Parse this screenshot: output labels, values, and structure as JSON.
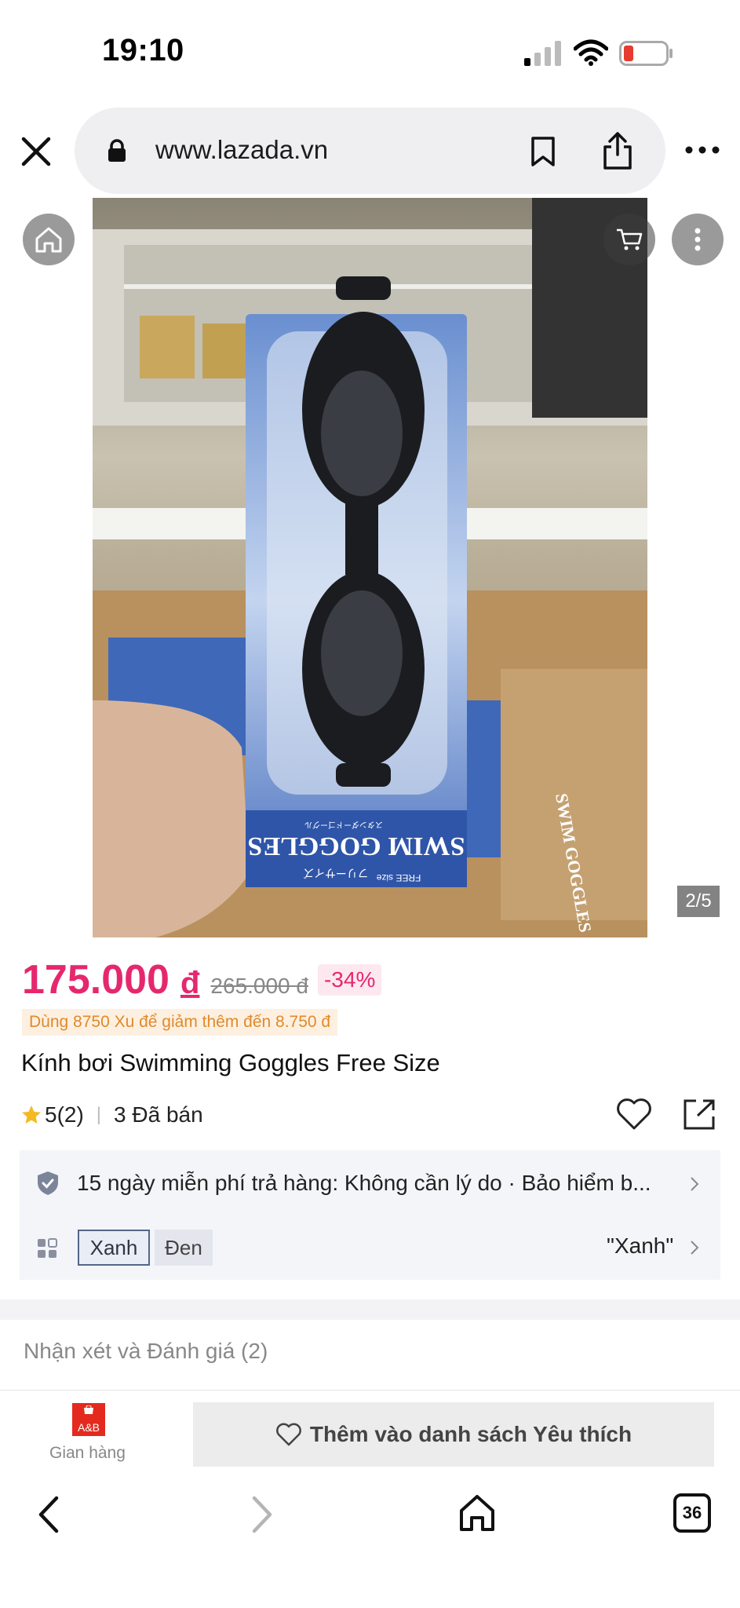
{
  "status_bar": {
    "time": "19:10"
  },
  "browser": {
    "url": "www.lazada.vn"
  },
  "product": {
    "image_counter": "2/5",
    "price": "175.000",
    "currency": "đ",
    "old_price": "265.000 đ",
    "discount": "-34%",
    "coin_note": "Dùng 8750 Xu để giảm thêm đến 8.750 đ",
    "title": "Kính bơi Swimming Goggles Free Size",
    "rating": "5(2)",
    "sold": "3 Đã bán",
    "packaging_text": "SWIM GOGGLES",
    "packaging_size": "FREE size",
    "packaging_jp": "フリーサイズ",
    "packaging_jp_sub": "スタンダードゴーグル"
  },
  "info_card": {
    "return_policy": "15 ngày miễn phí trả hàng: Không cần lý do · Bảo hiểm b...",
    "variants": [
      "Xanh",
      "Đen"
    ],
    "selected_variant": "\"Xanh\""
  },
  "reviews": {
    "title": "Nhận xét và Đánh giá (2)"
  },
  "action_bar": {
    "store_badge": "A&B",
    "store_label": "Gian hàng",
    "wishlist_label": "Thêm vào danh sách Yêu thích"
  },
  "nav": {
    "tab_count": "36"
  },
  "colors": {
    "accent": "#e5286e",
    "coin": "#e08a2c"
  },
  "icons": [
    "signal-icon",
    "wifi-icon",
    "battery-icon",
    "close-icon",
    "lock-icon",
    "bookmark-icon",
    "share-icon",
    "more-icon",
    "home-icon",
    "cart-icon",
    "star-icon",
    "heart-icon",
    "external-share-icon",
    "shield-icon",
    "variant-icon",
    "chevron-right-icon",
    "back-icon",
    "forward-icon",
    "tabs-icon"
  ]
}
